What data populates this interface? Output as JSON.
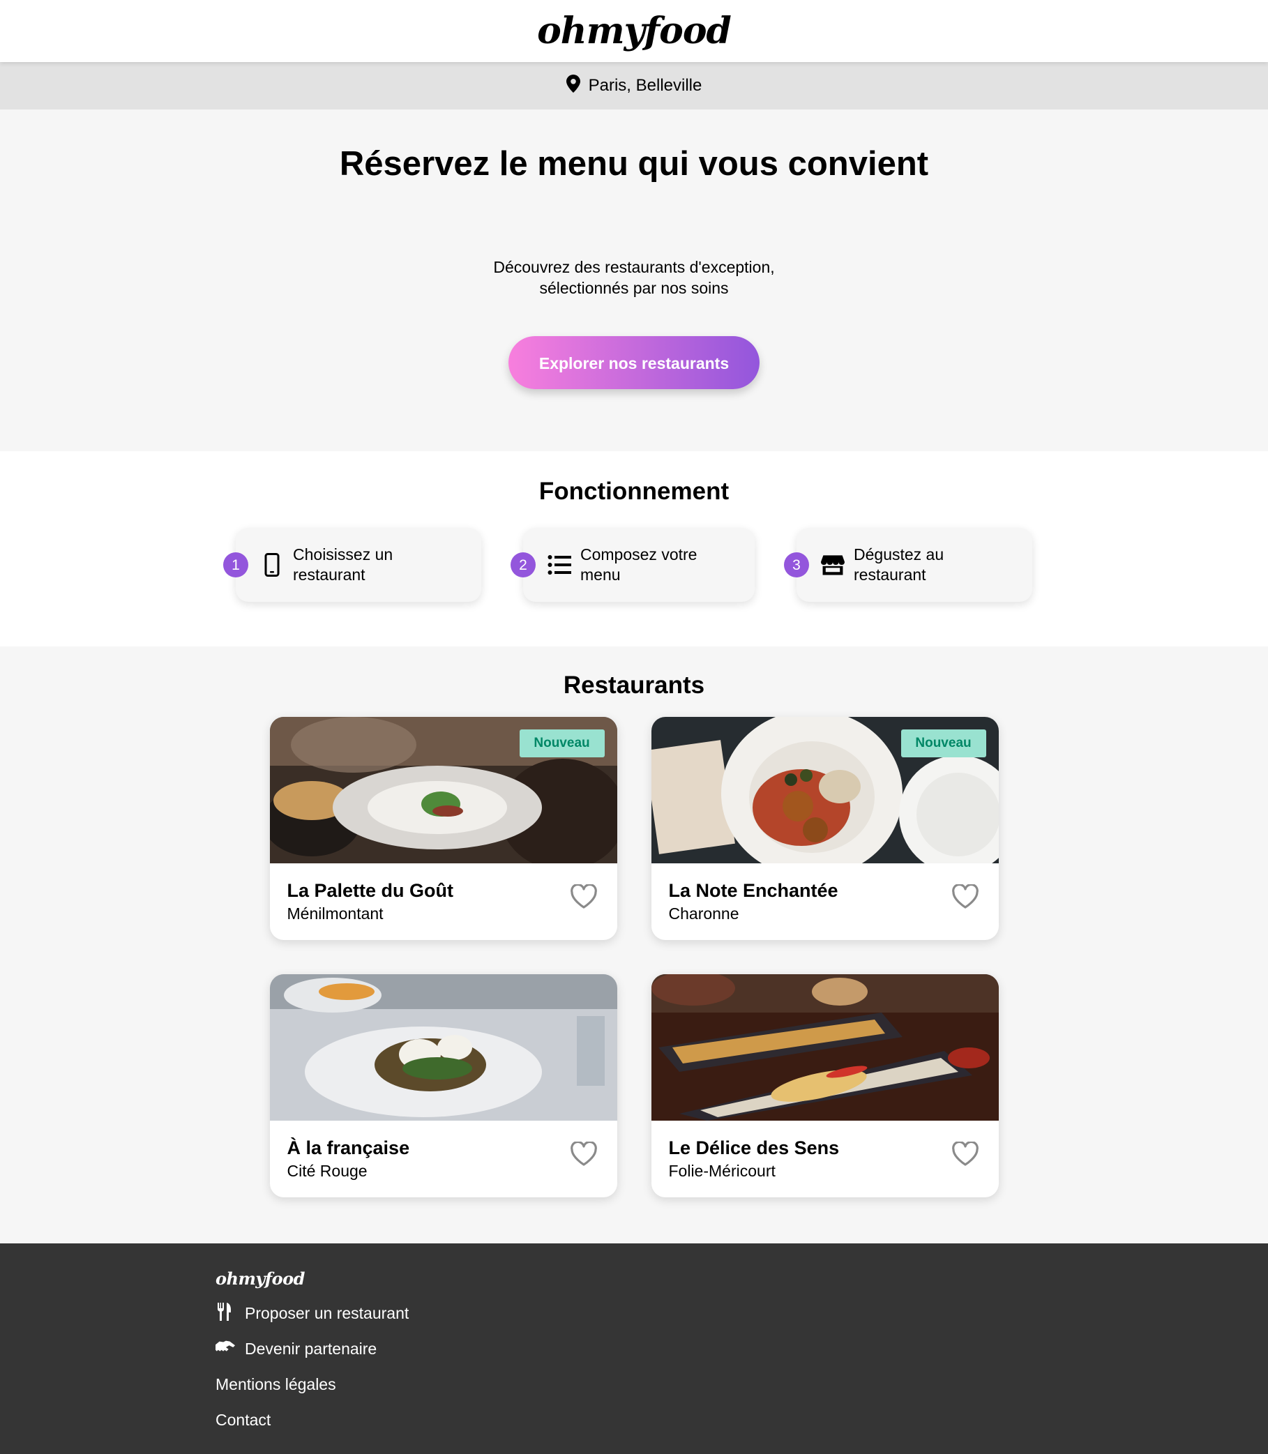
{
  "header": {
    "logo": "ohmyfood"
  },
  "location": {
    "text": "Paris, Belleville",
    "icon": "map-pin-icon"
  },
  "hero": {
    "title": "Réservez le menu qui vous convient",
    "subtitle_line1": "Découvrez des restaurants d'exception,",
    "subtitle_line2": "sélectionnés par nos soins",
    "cta": "Explorer nos restaurants"
  },
  "how": {
    "title": "Fonctionnement",
    "steps": [
      {
        "num": "1",
        "line1": "Choisissez un",
        "line2": "restaurant",
        "icon": "mobile-phone-icon"
      },
      {
        "num": "2",
        "line1": "Composez votre",
        "line2": "menu",
        "icon": "list-icon"
      },
      {
        "num": "3",
        "line1": "Dégustez au",
        "line2": "restaurant",
        "icon": "store-icon"
      }
    ]
  },
  "restaurants": {
    "title": "Restaurants",
    "badge": "Nouveau",
    "items": [
      {
        "name": "La Palette du Goût",
        "area": "Ménilmontant",
        "new": true
      },
      {
        "name": "La Note Enchantée",
        "area": "Charonne",
        "new": true
      },
      {
        "name": "À la française",
        "area": "Cité Rouge",
        "new": false
      },
      {
        "name": "Le Délice des Sens",
        "area": "Folie-Méricourt",
        "new": false
      }
    ]
  },
  "footer": {
    "logo": "ohmyfood",
    "links": [
      {
        "label": "Proposer un restaurant",
        "icon": "utensils-icon"
      },
      {
        "label": "Devenir partenaire",
        "icon": "handshake-icon"
      },
      {
        "label": "Mentions légales"
      },
      {
        "label": "Contact"
      }
    ]
  }
}
